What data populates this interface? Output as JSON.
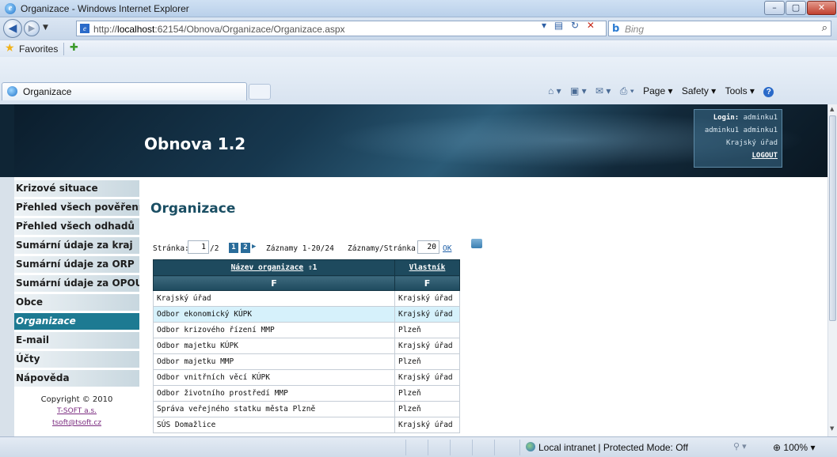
{
  "window": {
    "title": "Organizace - Windows Internet Explorer",
    "min": "–",
    "max": "▢",
    "close": "✕"
  },
  "addressbar": {
    "url_prefix": "http://",
    "url_host": "localhost",
    "url_rest": ":62154/Obnova/Organizace/Organizace.aspx",
    "search_placeholder": "Bing"
  },
  "favorites": {
    "label": "Favorites"
  },
  "tab": {
    "label": "Organizace"
  },
  "commandbar": {
    "page": "Page ▾",
    "safety": "Safety ▾",
    "tools": "Tools ▾"
  },
  "site": {
    "title": "Obnova 1.2",
    "login": {
      "label": "Login:",
      "user": "adminku1",
      "fullname": "adminku1 adminku1",
      "office": "Krajský úřad",
      "logout": "LOGOUT"
    }
  },
  "menu": {
    "items": [
      {
        "label": "Krizové situace",
        "active": false
      },
      {
        "label": "Přehled všech pověření",
        "active": false
      },
      {
        "label": "Přehled všech odhadů",
        "active": false
      },
      {
        "label": "Sumární údaje za kraj",
        "active": false
      },
      {
        "label": "Sumární údaje za ORP",
        "active": false
      },
      {
        "label": "Sumární údaje za OPOU",
        "active": false
      },
      {
        "label": "Obce",
        "active": false
      },
      {
        "label": "Organizace",
        "active": true
      },
      {
        "label": "E-mail",
        "active": false
      },
      {
        "label": "Účty",
        "active": false
      },
      {
        "label": "Nápověda",
        "active": false
      }
    ]
  },
  "footer": {
    "copyright": "Copyright © 2010",
    "company": "T-SOFT a.s.",
    "email": "tsoft@tsoft.cz"
  },
  "content": {
    "title": "Organizace",
    "pager": {
      "page_label": "Stránka:",
      "page_value": "1",
      "page_total": "/2",
      "page1": "1",
      "page2": "2",
      "records": "Záznamy 1-20/24",
      "per_page_label": "Záznamy/Stránka",
      "per_page_value": "20",
      "ok": "OK"
    },
    "table": {
      "headers": [
        "Název organizace",
        "Vlastník"
      ],
      "sort_indicator": "⇧",
      "sort_number": "1",
      "filters": [
        "F",
        "F"
      ],
      "rows": [
        [
          "Krajský úřad",
          "Krajský úřad"
        ],
        [
          "Odbor ekonomický KÚPK",
          "Krajský úřad"
        ],
        [
          "Odbor krizového řízení MMP",
          "Plzeň"
        ],
        [
          "Odbor majetku KÚPK",
          "Krajský úřad"
        ],
        [
          "Odbor majetku MMP",
          "Plzeň"
        ],
        [
          "Odbor vnitřních věcí KÚPK",
          "Krajský úřad"
        ],
        [
          "Odbor životního prostředí MMP",
          "Plzeň"
        ],
        [
          "Správa veřejného statku města Plzně",
          "Plzeň"
        ],
        [
          "SÚS Domažlice",
          "Krajský úřad"
        ]
      ],
      "highlighted_row": 1
    }
  },
  "statusbar": {
    "zone": "Local intranet | Protected Mode: Off",
    "zoom": "100%"
  },
  "colors": {
    "accent": "#1d7a92",
    "header_dark": "#1e4a5e",
    "highlight_row": "#d6f1fb"
  }
}
